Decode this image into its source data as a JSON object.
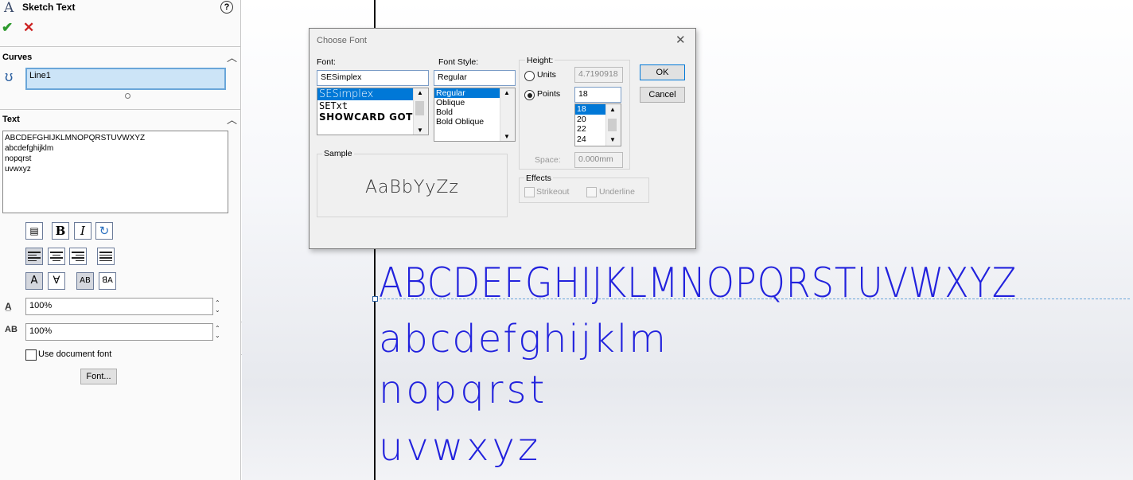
{
  "panel": {
    "title": "Sketch Text",
    "curves": {
      "title": "Curves",
      "selection": "Line1"
    },
    "text": {
      "title": "Text",
      "lines": [
        "ABCDEFGHIJKLMNOPQRSTUVWXYZ",
        "abcdefghijklm",
        "nopqrst",
        "uvwxyz"
      ]
    },
    "width_factor": "100%",
    "spacing": "100%",
    "use_document_font_label": "Use document font",
    "use_document_font_checked": false,
    "font_button": "Font..."
  },
  "canvas": {
    "lines": [
      "ABCDEFGHIJKLMNOPQRSTUVWXYZ",
      "abcdefghijklm",
      "nopqrst",
      "uvwxyz"
    ],
    "text_color": "#2222dd"
  },
  "dialog": {
    "title": "Choose Font",
    "font_label": "Font:",
    "font_value": "SESimplex",
    "font_list": [
      "SESimplex",
      "SETxt",
      "SHOWCARD GOTH"
    ],
    "style_label": "Font Style:",
    "style_value": "Regular",
    "style_list": [
      "Regular",
      "Oblique",
      "Bold",
      "Bold Oblique"
    ],
    "height_label": "Height:",
    "units_label": "Units",
    "units_value": "4.7190918",
    "points_label": "Points",
    "points_value": "18",
    "points_list": [
      "18",
      "20",
      "22",
      "24"
    ],
    "space_label": "Space:",
    "space_value": "0.000mm",
    "effects_label": "Effects",
    "strikeout_label": "Strikeout",
    "underline_label": "Underline",
    "sample_label": "Sample",
    "sample_text": "AaBbYyZz",
    "ok": "OK",
    "cancel": "Cancel"
  }
}
